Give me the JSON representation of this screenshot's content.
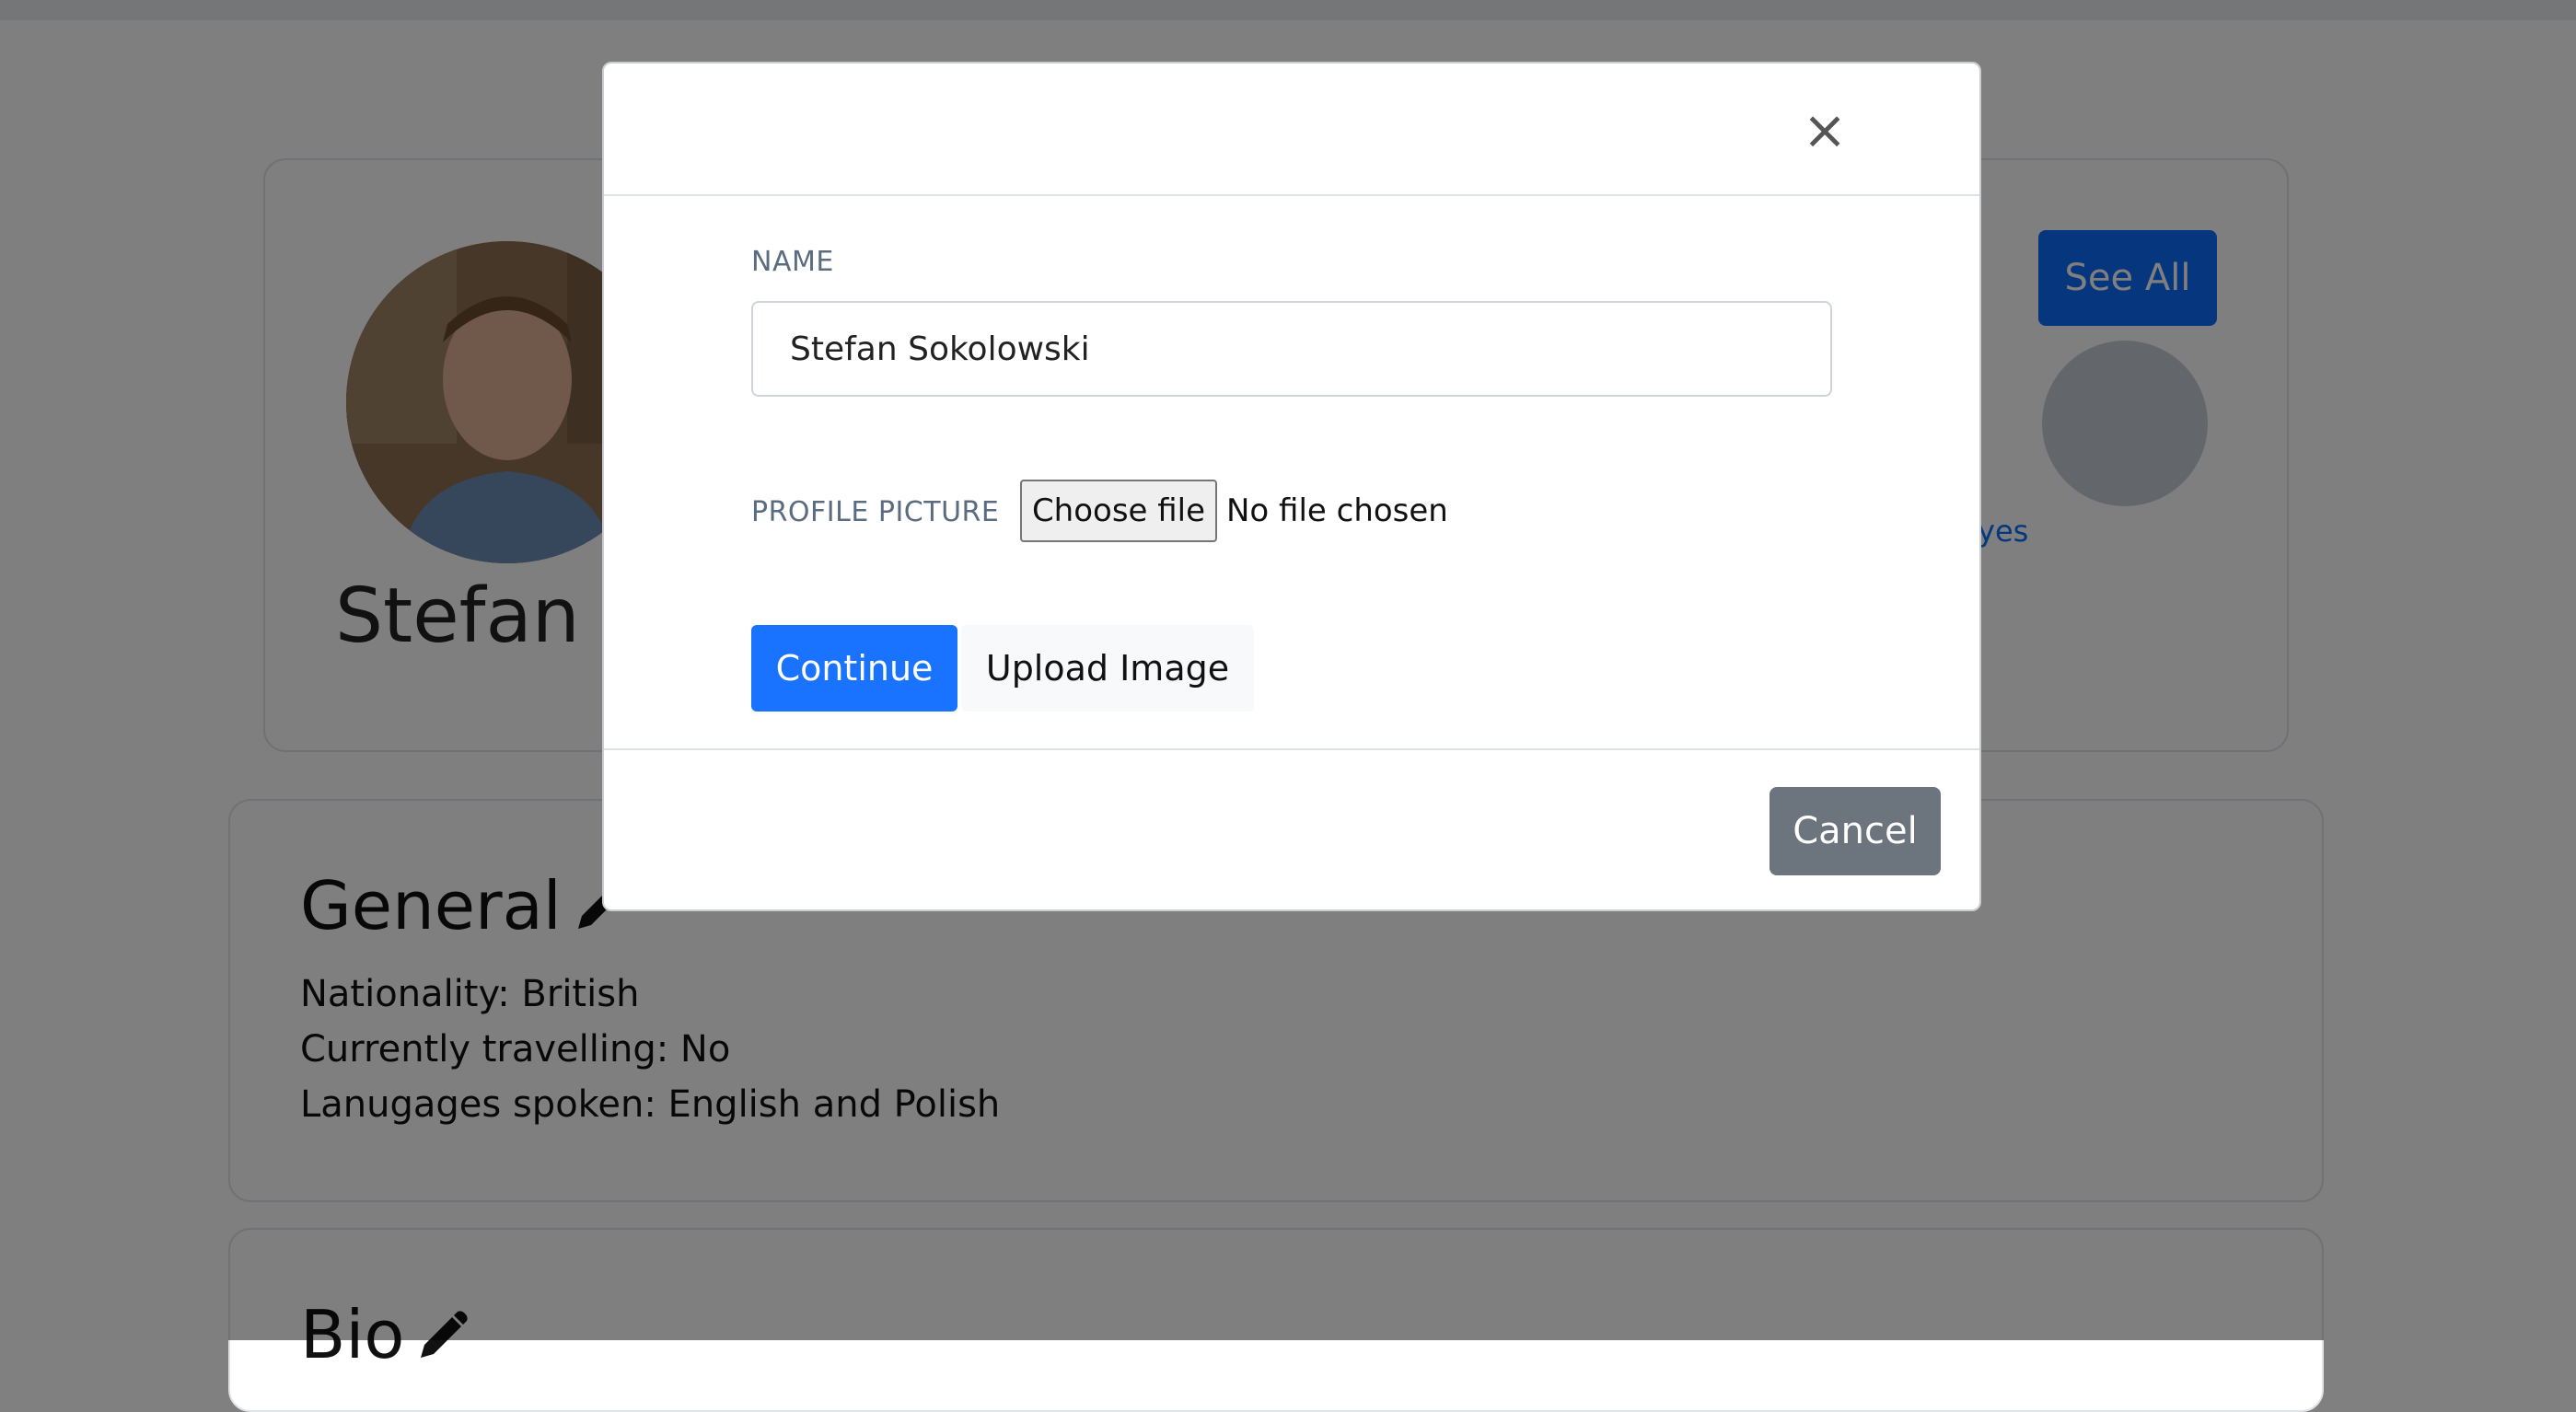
{
  "background": {
    "profile": {
      "name_partial": "Stefan S",
      "see_all_label": "See All",
      "friend_name_partial": "yes",
      "avatar_icon": "person-photo"
    },
    "general": {
      "title": "General",
      "edit_icon": "pencil-icon",
      "lines": [
        "Nationality: British",
        "Currently travelling: No",
        "Lanugages spoken: English and Polish"
      ]
    },
    "bio": {
      "title": "Bio",
      "edit_icon": "pencil-icon"
    }
  },
  "modal": {
    "close_symbol": "×",
    "name_label": "NAME",
    "name_value": "Stefan Sokolowski",
    "profile_picture_label": "PROFILE PICTURE",
    "choose_file_label": "Choose file",
    "no_file_text": "No file chosen",
    "continue_label": "Continue",
    "upload_label": "Upload Image",
    "cancel_label": "Cancel"
  },
  "colors": {
    "primary": "#1a73ff",
    "secondary": "#6c757d",
    "label": "#5b6b80"
  }
}
